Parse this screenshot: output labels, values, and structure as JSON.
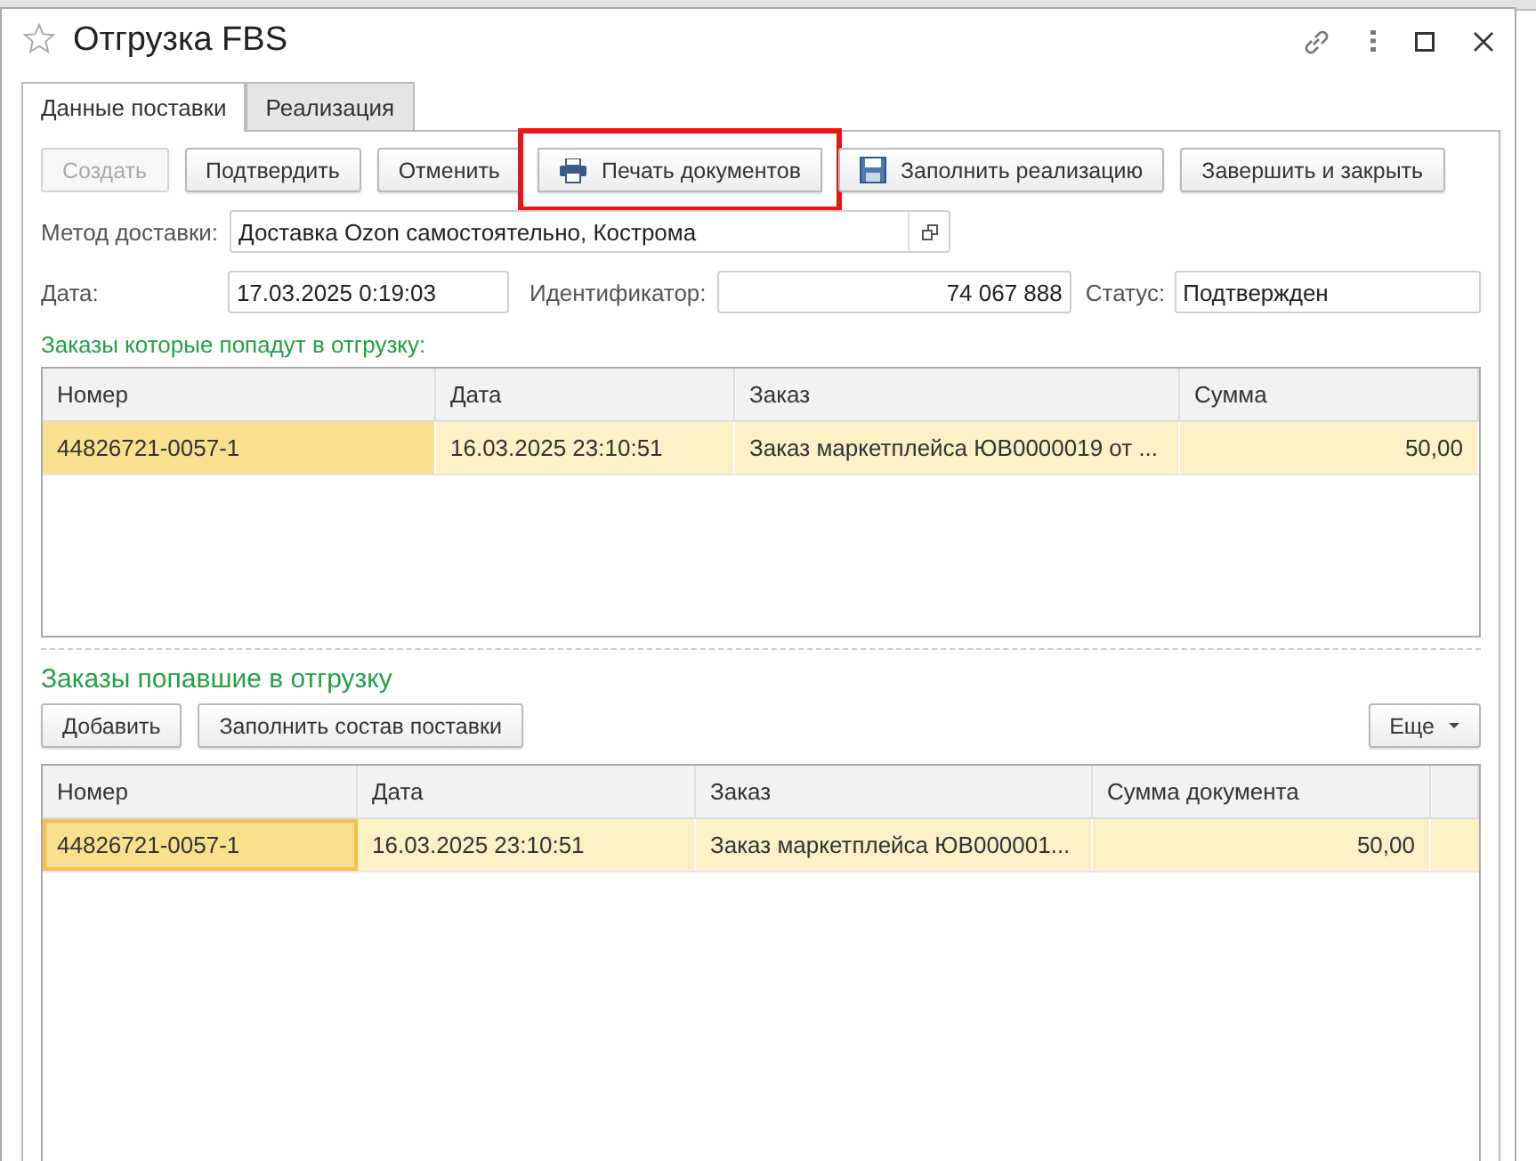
{
  "window": {
    "title": "Отгрузка FBS",
    "favorite": false
  },
  "tabs": [
    {
      "label": "Данные поставки",
      "selected": true
    },
    {
      "label": "Реализация",
      "selected": false
    }
  ],
  "toolbar": [
    {
      "label": "Создать",
      "disabled": true,
      "kind": "plain",
      "highlighted": false
    },
    {
      "label": "Подтвердить",
      "disabled": false,
      "kind": "plain",
      "highlighted": false
    },
    {
      "label": "Отменить",
      "disabled": false,
      "kind": "plain",
      "highlighted": false
    },
    {
      "label": "Печать документов",
      "disabled": false,
      "kind": "print",
      "highlighted": true
    },
    {
      "label": "Заполнить реализацию",
      "disabled": false,
      "kind": "save",
      "highlighted": false
    },
    {
      "label": "Завершить и закрыть",
      "disabled": false,
      "kind": "plain",
      "highlighted": false
    }
  ],
  "delivery_method": {
    "label": "Метод доставки:",
    "value": "Доставка Ozon самостоятельно, Кострома"
  },
  "date": {
    "label": "Дата:",
    "value": "17.03.2025  0:19:03"
  },
  "identifier": {
    "label": "Идентификатор:",
    "value": "74 067 888"
  },
  "status": {
    "label": "Статус:",
    "value": "Подтвержден"
  },
  "orders_to_ship": {
    "title": "Заказы которые попадут в отгрузку:",
    "focused": false,
    "columns": [
      {
        "label": "Номер",
        "numeric": false
      },
      {
        "label": "Дата",
        "numeric": false
      },
      {
        "label": "Заказ",
        "numeric": false
      },
      {
        "label": "Сумма",
        "numeric": true
      }
    ],
    "rows": [
      {
        "selected": true,
        "cells": [
          "44826721-0057-1",
          "16.03.2025 23:10:51",
          "Заказ маркетплейса ЮВ0000019 от ...",
          "50,00"
        ]
      }
    ]
  },
  "shipped_orders": {
    "title": "Заказы попавшие в отгрузку",
    "focused": true,
    "buttons": [
      {
        "label": "Добавить"
      },
      {
        "label": "Заполнить состав поставки"
      }
    ],
    "more_button": {
      "label": "Еще"
    },
    "columns": [
      {
        "label": "Номер",
        "numeric": false
      },
      {
        "label": "Дата",
        "numeric": false
      },
      {
        "label": "Заказ",
        "numeric": false
      },
      {
        "label": "Сумма документа",
        "numeric": true
      }
    ],
    "rows": [
      {
        "selected": true,
        "cells": [
          "44826721-0057-1",
          "16.03.2025 23:10:51",
          "Заказ маркетплейса ЮВ000001...",
          "50,00"
        ]
      }
    ]
  }
}
